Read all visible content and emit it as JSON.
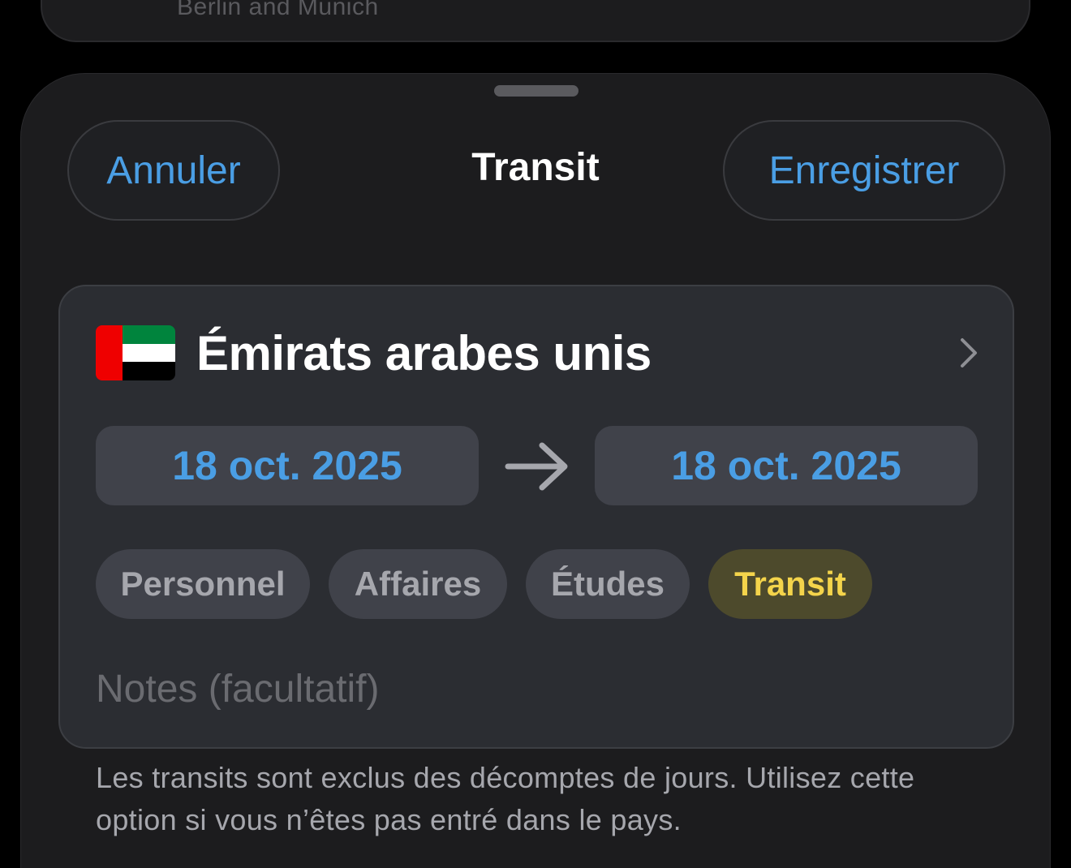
{
  "previous_card": {
    "text": "Berlin and Munich"
  },
  "sheet": {
    "title": "Transit",
    "cancel_label": "Annuler",
    "save_label": "Enregistrer"
  },
  "entry": {
    "country": "Émirats arabes unis",
    "flag_icon": "uae-flag-icon",
    "flag_colors": {
      "red": "#ef0000",
      "green": "#00843d",
      "white": "#ffffff",
      "black": "#000000"
    },
    "start_date": "18 oct. 2025",
    "end_date": "18 oct. 2025",
    "categories": [
      {
        "label": "Personnel",
        "selected": false
      },
      {
        "label": "Affaires",
        "selected": false
      },
      {
        "label": "Études",
        "selected": false
      },
      {
        "label": "Transit",
        "selected": true
      }
    ],
    "notes_placeholder": "Notes (facultatif)",
    "notes_value": ""
  },
  "footnote": "Les transits sont exclus des décomptes de jours. Utilisez cette option si vous n’êtes pas entré dans le pays.",
  "colors": {
    "accent_blue": "#4a9ee4",
    "transit_yellow": "#f4d44b",
    "background": "#000000",
    "sheet": "#1c1c1e",
    "card": "#2b2d32"
  }
}
